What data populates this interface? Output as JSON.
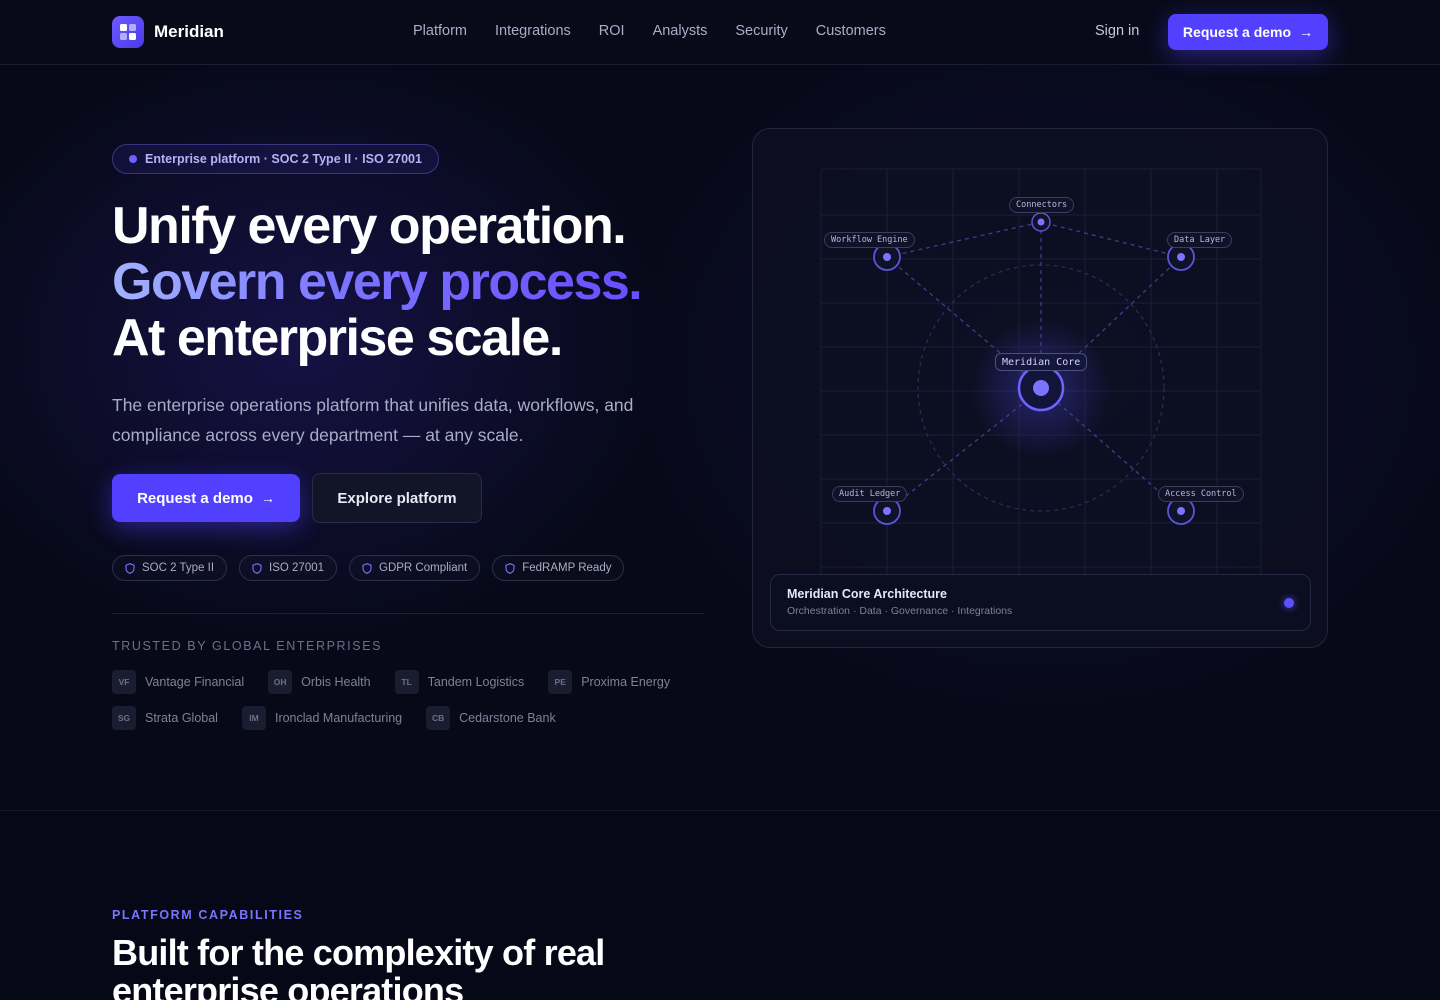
{
  "brand": {
    "name": "Meridian"
  },
  "nav": {
    "links": [
      "Platform",
      "Integrations",
      "ROI",
      "Analysts",
      "Security",
      "Customers"
    ],
    "sign_in": "Sign in",
    "cta": "Request a demo"
  },
  "hero": {
    "pill": "Enterprise platform · SOC 2 Type II · ISO 27001",
    "headline_line1": "Unify every operation.",
    "headline_line2": "Govern every process.",
    "headline_line3": "At enterprise scale.",
    "subtext": "The enterprise operations platform that unifies data, workflows, and compliance across every department — at any scale.",
    "primary_cta": "Request a demo",
    "secondary_cta": "Explore platform",
    "badges": [
      "SOC 2 Type II",
      "ISO 27001",
      "GDPR Compliant",
      "FedRAMP Ready"
    ],
    "trusted_label": "TRUSTED BY GLOBAL ENTERPRISES",
    "companies_row1": [
      {
        "abbr": "VF",
        "name": "Vantage Financial"
      },
      {
        "abbr": "OH",
        "name": "Orbis Health"
      },
      {
        "abbr": "TL",
        "name": "Tandem Logistics"
      },
      {
        "abbr": "PE",
        "name": "Proxima Energy"
      }
    ],
    "companies_row2": [
      {
        "abbr": "SG",
        "name": "Strata Global"
      },
      {
        "abbr": "IM",
        "name": "Ironclad Manufacturing"
      },
      {
        "abbr": "CB",
        "name": "Cedarstone Bank"
      }
    ]
  },
  "architecture": {
    "core_label": "Meridian Core",
    "nodes": {
      "connectors": "Connectors",
      "workflow_engine": "Workflow Engine",
      "data_layer": "Data Layer",
      "audit_ledger": "Audit Ledger",
      "access_control": "Access Control"
    },
    "footer_title": "Meridian Core Architecture",
    "footer_subtitle": "Orchestration · Data · Governance · Integrations"
  },
  "capabilities": {
    "eyebrow": "PLATFORM CAPABILITIES",
    "title": "Built for the complexity of real enterprise operations"
  },
  "colors": {
    "accent": "#5240ff",
    "background": "#070919",
    "gradient_start": "#a3b2ff",
    "gradient_end": "#6a4dff"
  }
}
